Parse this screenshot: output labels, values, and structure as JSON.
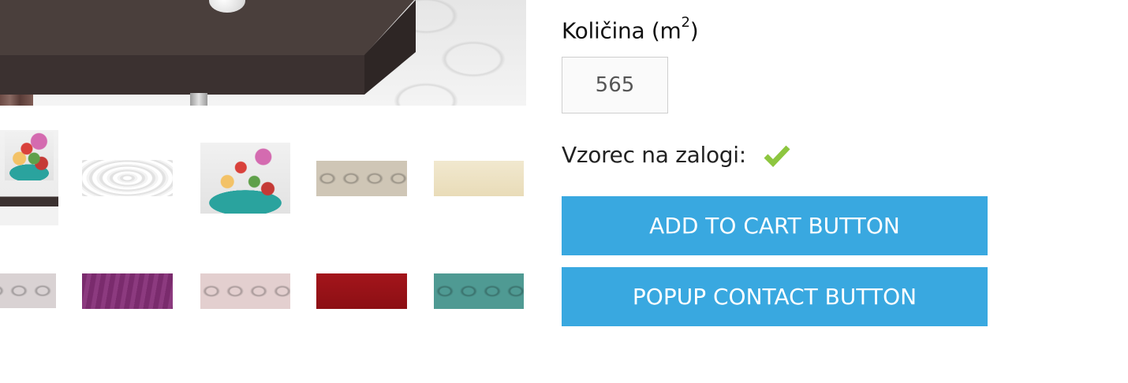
{
  "product": {
    "quantity_label": "Količina (m",
    "quantity_unit_sup": "2",
    "quantity_label_close": ")",
    "quantity_value": "565",
    "stock_label": "Vzorec na zalogi:",
    "stock_icon": "check-icon",
    "stock_icon_color": "#8dc63f"
  },
  "actions": {
    "add_to_cart_label": "ADD TO CART BUTTON",
    "popup_contact_label": "POPUP CONTACT BUTTON",
    "button_color": "#39a8e0"
  },
  "gallery": {
    "thumbnails": [
      {
        "name": "fruit-decor-interior"
      },
      {
        "name": "white-wave-tile"
      },
      {
        "name": "fruit-decor-tile"
      },
      {
        "name": "beige-ring-tile"
      },
      {
        "name": "cream-tile"
      },
      {
        "name": "grey-ring-tile"
      },
      {
        "name": "purple-wave-tile"
      },
      {
        "name": "rose-ring-tile"
      },
      {
        "name": "red-tile"
      },
      {
        "name": "teal-ring-tile"
      }
    ]
  }
}
